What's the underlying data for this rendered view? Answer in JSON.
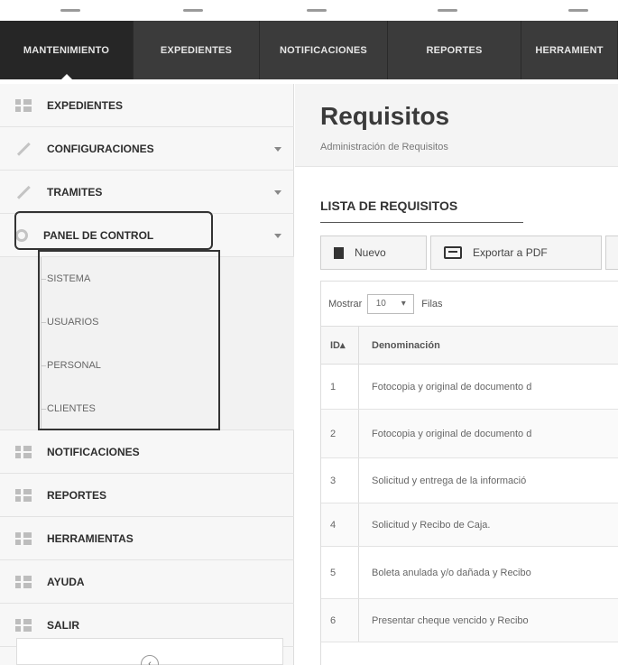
{
  "topnav": {
    "tabs": [
      {
        "label": "MANTENIMIENTO",
        "active": true
      },
      {
        "label": "EXPEDIENTES",
        "active": false
      },
      {
        "label": "NOTIFICACIONES",
        "active": false
      },
      {
        "label": "REPORTES",
        "active": false
      },
      {
        "label": "HERRAMIENT",
        "active": false
      }
    ]
  },
  "sidebar": {
    "items": [
      {
        "label": "EXPEDIENTES",
        "icon": "grid-icon"
      },
      {
        "label": "CONFIGURACIONES",
        "icon": "pencil-icon"
      },
      {
        "label": "TRAMITES",
        "icon": "pencil-icon"
      },
      {
        "label": "PANEL DE CONTROL",
        "icon": "gear-icon"
      },
      {
        "label": "NOTIFICACIONES",
        "icon": "grid-icon"
      },
      {
        "label": "REPORTES",
        "icon": "grid-icon"
      },
      {
        "label": "HERRAMIENTAS",
        "icon": "grid-icon"
      },
      {
        "label": "AYUDA",
        "icon": "grid-icon"
      },
      {
        "label": "SALIR",
        "icon": "grid-icon"
      }
    ],
    "subitems": [
      "SISTEMA",
      "USUARIOS",
      "PERSONAL",
      "CLIENTES"
    ]
  },
  "main": {
    "title": "Requisitos",
    "subtitle": "Administración de Requisitos",
    "section_title": "LISTA DE REQUISITOS",
    "buttons": {
      "new": "Nuevo",
      "export": "Exportar a PDF"
    },
    "show": {
      "prefix": "Mostrar",
      "value": "10",
      "suffix": "Filas"
    },
    "table": {
      "headers": {
        "id": "ID▴",
        "name": "Denominación"
      },
      "rows": [
        {
          "id": "1",
          "name": "Fotocopia y original de documento d"
        },
        {
          "id": "2",
          "name": "Fotocopia y original de documento d"
        },
        {
          "id": "3",
          "name": "Solicitud y entrega de la informació"
        },
        {
          "id": "4",
          "name": "Solicitud y Recibo de Caja."
        },
        {
          "id": "5",
          "name": "Boleta anulada y/o dañada y Recibo"
        },
        {
          "id": "6",
          "name": "Presentar cheque vencido y Recibo"
        }
      ]
    }
  },
  "collapse": {
    "icon": "chevron-icon",
    "glyph": "‹"
  }
}
